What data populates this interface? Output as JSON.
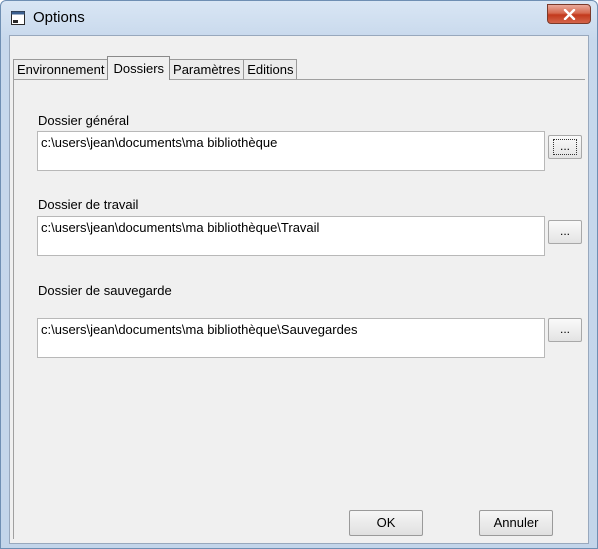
{
  "window": {
    "title": "Options"
  },
  "tabs": [
    {
      "label": "Environnement",
      "active": false
    },
    {
      "label": "Dossiers",
      "active": true
    },
    {
      "label": "Paramètres",
      "active": false
    },
    {
      "label": "Editions",
      "active": false
    }
  ],
  "fields": {
    "general": {
      "label": "Dossier général",
      "value": "c:\\users\\jean\\documents\\ma bibliothèque",
      "browse_label": "..."
    },
    "work": {
      "label": "Dossier de travail",
      "value": "c:\\users\\jean\\documents\\ma bibliothèque\\Travail",
      "browse_label": "..."
    },
    "backup": {
      "label": "Dossier de sauvegarde",
      "value": "c:\\users\\jean\\documents\\ma bibliothèque\\Sauvegardes",
      "browse_label": "..."
    }
  },
  "buttons": {
    "ok_label": "OK",
    "cancel_label": "Annuler"
  },
  "icons": {
    "window_icon": "window-icon",
    "close_icon": "close-icon"
  },
  "colors": {
    "close_button": "#c3391c",
    "frame": "#c7d8ec",
    "client": "#f0f0f0"
  }
}
